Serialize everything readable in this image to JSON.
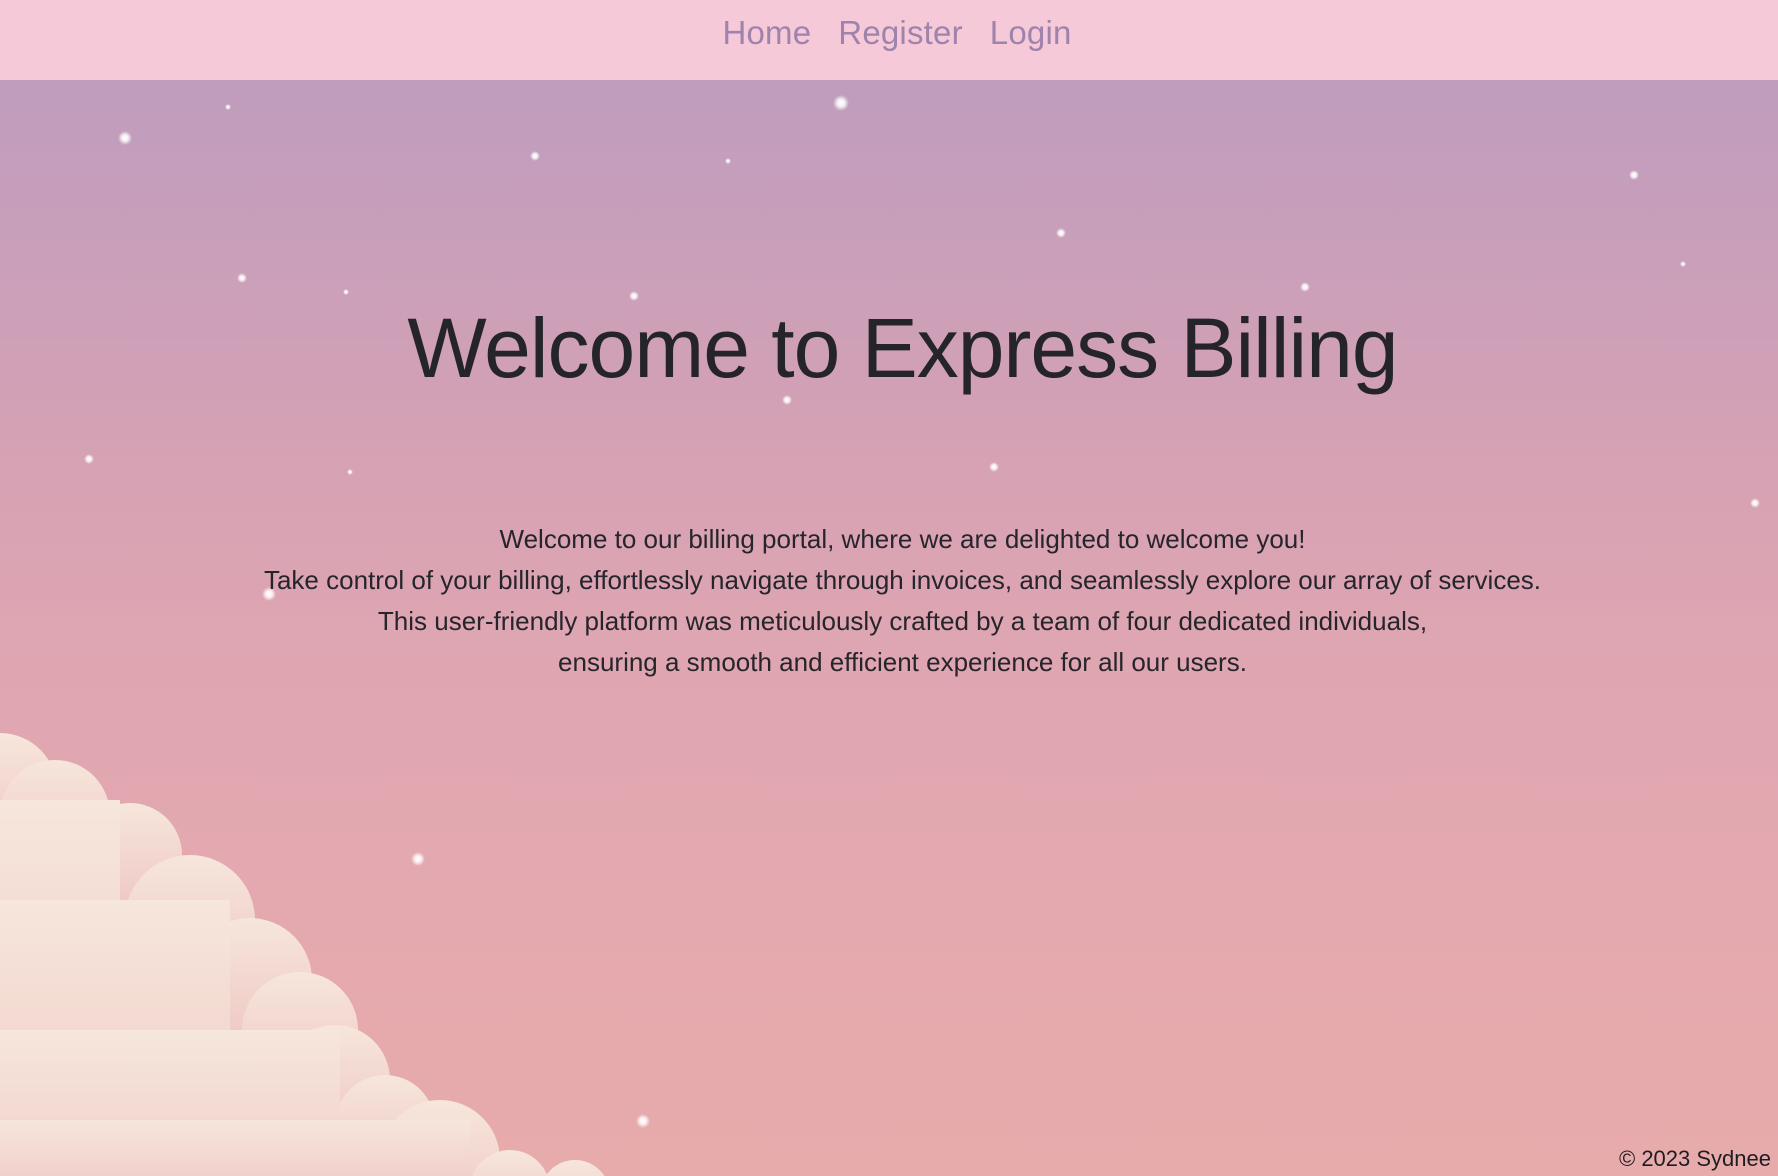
{
  "nav": {
    "links": [
      "Home",
      "Register",
      "Login"
    ]
  },
  "hero": {
    "title": "Welcome to Express Billing"
  },
  "intro": {
    "lines": [
      "Welcome to our billing portal, where we are delighted to welcome you!",
      "Take control of your billing, effortlessly navigate through invoices, and seamlessly explore our array of services.",
      "This user-friendly platform was meticulously crafted by a team of four dedicated individuals,",
      "ensuring a smooth and efficient experience for all our users."
    ]
  },
  "footer": {
    "text": "© 2023 Sydnee"
  },
  "colors": {
    "navbar": "#f6c9d8",
    "nav_link": "#9e83ad",
    "sky_top": "#bf9dbd",
    "sky_bottom": "#e8abab",
    "cloud": "#f4e2da",
    "text": "#25242a"
  }
}
